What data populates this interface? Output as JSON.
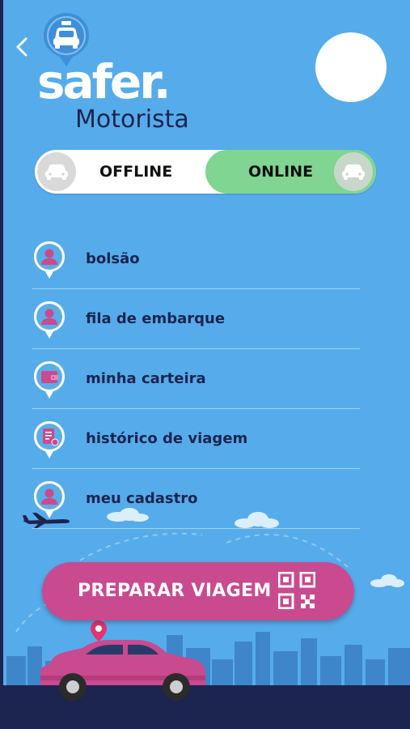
{
  "header": {
    "brand": "safer.",
    "subtitle": "Motorista"
  },
  "status_toggle": {
    "offline_label": "OFFLINE",
    "online_label": "ONLINE",
    "selected": "ONLINE"
  },
  "menu": {
    "items": [
      {
        "label": "bolsão",
        "icon": "user-icon"
      },
      {
        "label": "fila de embarque",
        "icon": "user-icon"
      },
      {
        "label": "minha carteira",
        "icon": "wallet-icon"
      },
      {
        "label": "histórico de viagem",
        "icon": "document-icon"
      },
      {
        "label": "meu cadastro",
        "icon": "user-icon"
      }
    ]
  },
  "cta": {
    "label": "PREPARAR VIAGEM",
    "icon": "qr-code-icon"
  },
  "colors": {
    "background": "#56acea",
    "navy": "#1c2450",
    "accent_pink": "#c94a8f",
    "online_green": "#7fd591"
  }
}
